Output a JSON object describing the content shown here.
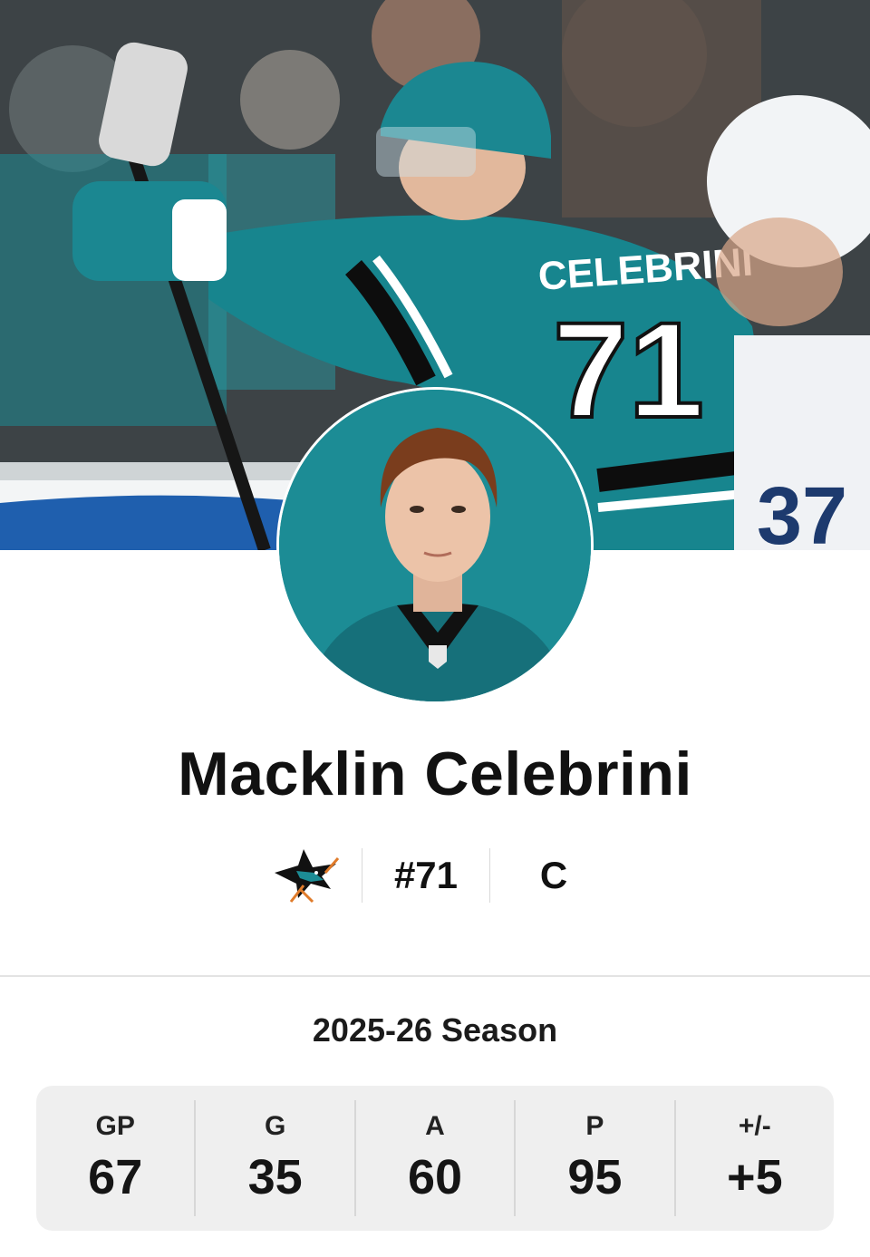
{
  "player": {
    "name": "Macklin Celebrini",
    "number": "#71",
    "position": "C",
    "team_logo_icon": "sharks-logo-icon",
    "hero_jersey_name": "CELEBRINI",
    "hero_jersey_number": "71",
    "opponent_jersey_number": "37"
  },
  "colors": {
    "teal": "#1c8c95",
    "dark_teal": "#0f6e77",
    "black": "#111111"
  },
  "season": {
    "title": "2025-26 Season",
    "stats": [
      {
        "label": "GP",
        "value": "67"
      },
      {
        "label": "G",
        "value": "35"
      },
      {
        "label": "A",
        "value": "60"
      },
      {
        "label": "P",
        "value": "95"
      },
      {
        "label": "+/-",
        "value": "+5"
      }
    ]
  }
}
